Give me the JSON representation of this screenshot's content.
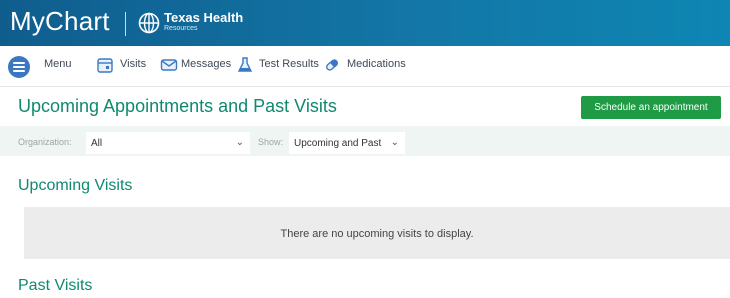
{
  "header": {
    "app_name": "MyChart",
    "org_line1": "Texas Health",
    "org_line2": "Resources"
  },
  "toolbar": {
    "menu": "Menu",
    "visits": "Visits",
    "messages": "Messages",
    "test_results": "Test Results",
    "medications": "Medications"
  },
  "page": {
    "title": "Upcoming Appointments and Past Visits",
    "schedule_button": "Schedule an appointment"
  },
  "filters": {
    "organization_label": "Organization:",
    "organization_value": "All",
    "show_label": "Show:",
    "show_value": "Upcoming and Past"
  },
  "upcoming": {
    "title": "Upcoming Visits",
    "empty_message": "There are no upcoming visits to display."
  },
  "past": {
    "title": "Past Visits"
  },
  "colors": {
    "header": "#1378a8",
    "accent_green_text": "#0f8a6f",
    "button_green": "#1f9b45",
    "filter_bg": "#eef5f3"
  }
}
